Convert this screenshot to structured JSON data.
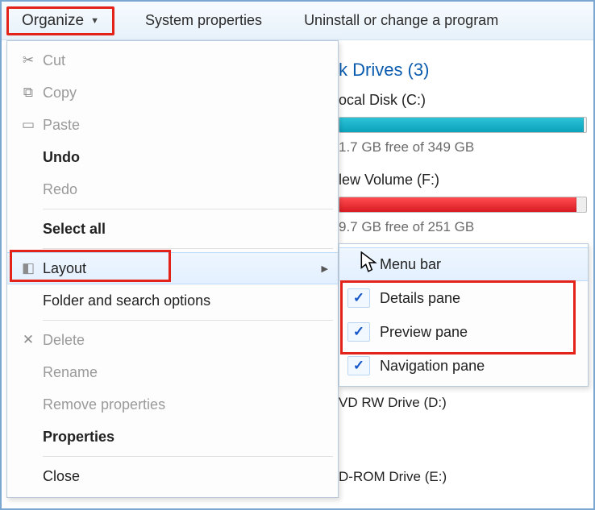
{
  "toolbar": {
    "organize_label": "Organize",
    "system_properties_label": "System properties",
    "uninstall_label": "Uninstall or change a program"
  },
  "drives_section": {
    "header": "k Drives (3)",
    "drives": [
      {
        "name": "ocal Disk (C:)",
        "free_text": "1.7 GB free of 349 GB",
        "fill_pct": 99,
        "bar_style": "teal"
      },
      {
        "name": "lew Volume (F:)",
        "free_text": "9.7 GB free of 251 GB",
        "fill_pct": 96,
        "bar_style": "red"
      }
    ],
    "extra_drives": [
      "VD RW Drive (D:)",
      "D-ROM Drive (E:)"
    ]
  },
  "organize_menu": {
    "items": [
      {
        "label": "Cut",
        "icon": "✂",
        "disabled": true
      },
      {
        "label": "Copy",
        "icon": "⧉",
        "disabled": true
      },
      {
        "label": "Paste",
        "icon": "▭",
        "disabled": true
      },
      {
        "label": "Undo",
        "bold": true
      },
      {
        "label": "Redo",
        "disabled": true
      },
      {
        "sep": true
      },
      {
        "label": "Select all",
        "bold": true
      },
      {
        "sep": true
      },
      {
        "label": "Layout",
        "icon": "◧",
        "hasSub": true,
        "hover": true,
        "highlight": true
      },
      {
        "label": "Folder and search options"
      },
      {
        "sep": true
      },
      {
        "label": "Delete",
        "icon": "✕",
        "disabled": true
      },
      {
        "label": "Rename",
        "disabled": true
      },
      {
        "label": "Remove properties",
        "disabled": true
      },
      {
        "label": "Properties",
        "bold": true
      },
      {
        "sep": true
      },
      {
        "label": "Close"
      }
    ]
  },
  "layout_submenu": {
    "items": [
      {
        "label": "Menu bar",
        "checked": false,
        "hover": true
      },
      {
        "label": "Details pane",
        "checked": true,
        "red_group": true
      },
      {
        "label": "Preview pane",
        "checked": true,
        "red_group": true
      },
      {
        "label": "Navigation pane",
        "checked": true
      }
    ]
  },
  "highlight_colors": {
    "red": "#e3231a"
  }
}
